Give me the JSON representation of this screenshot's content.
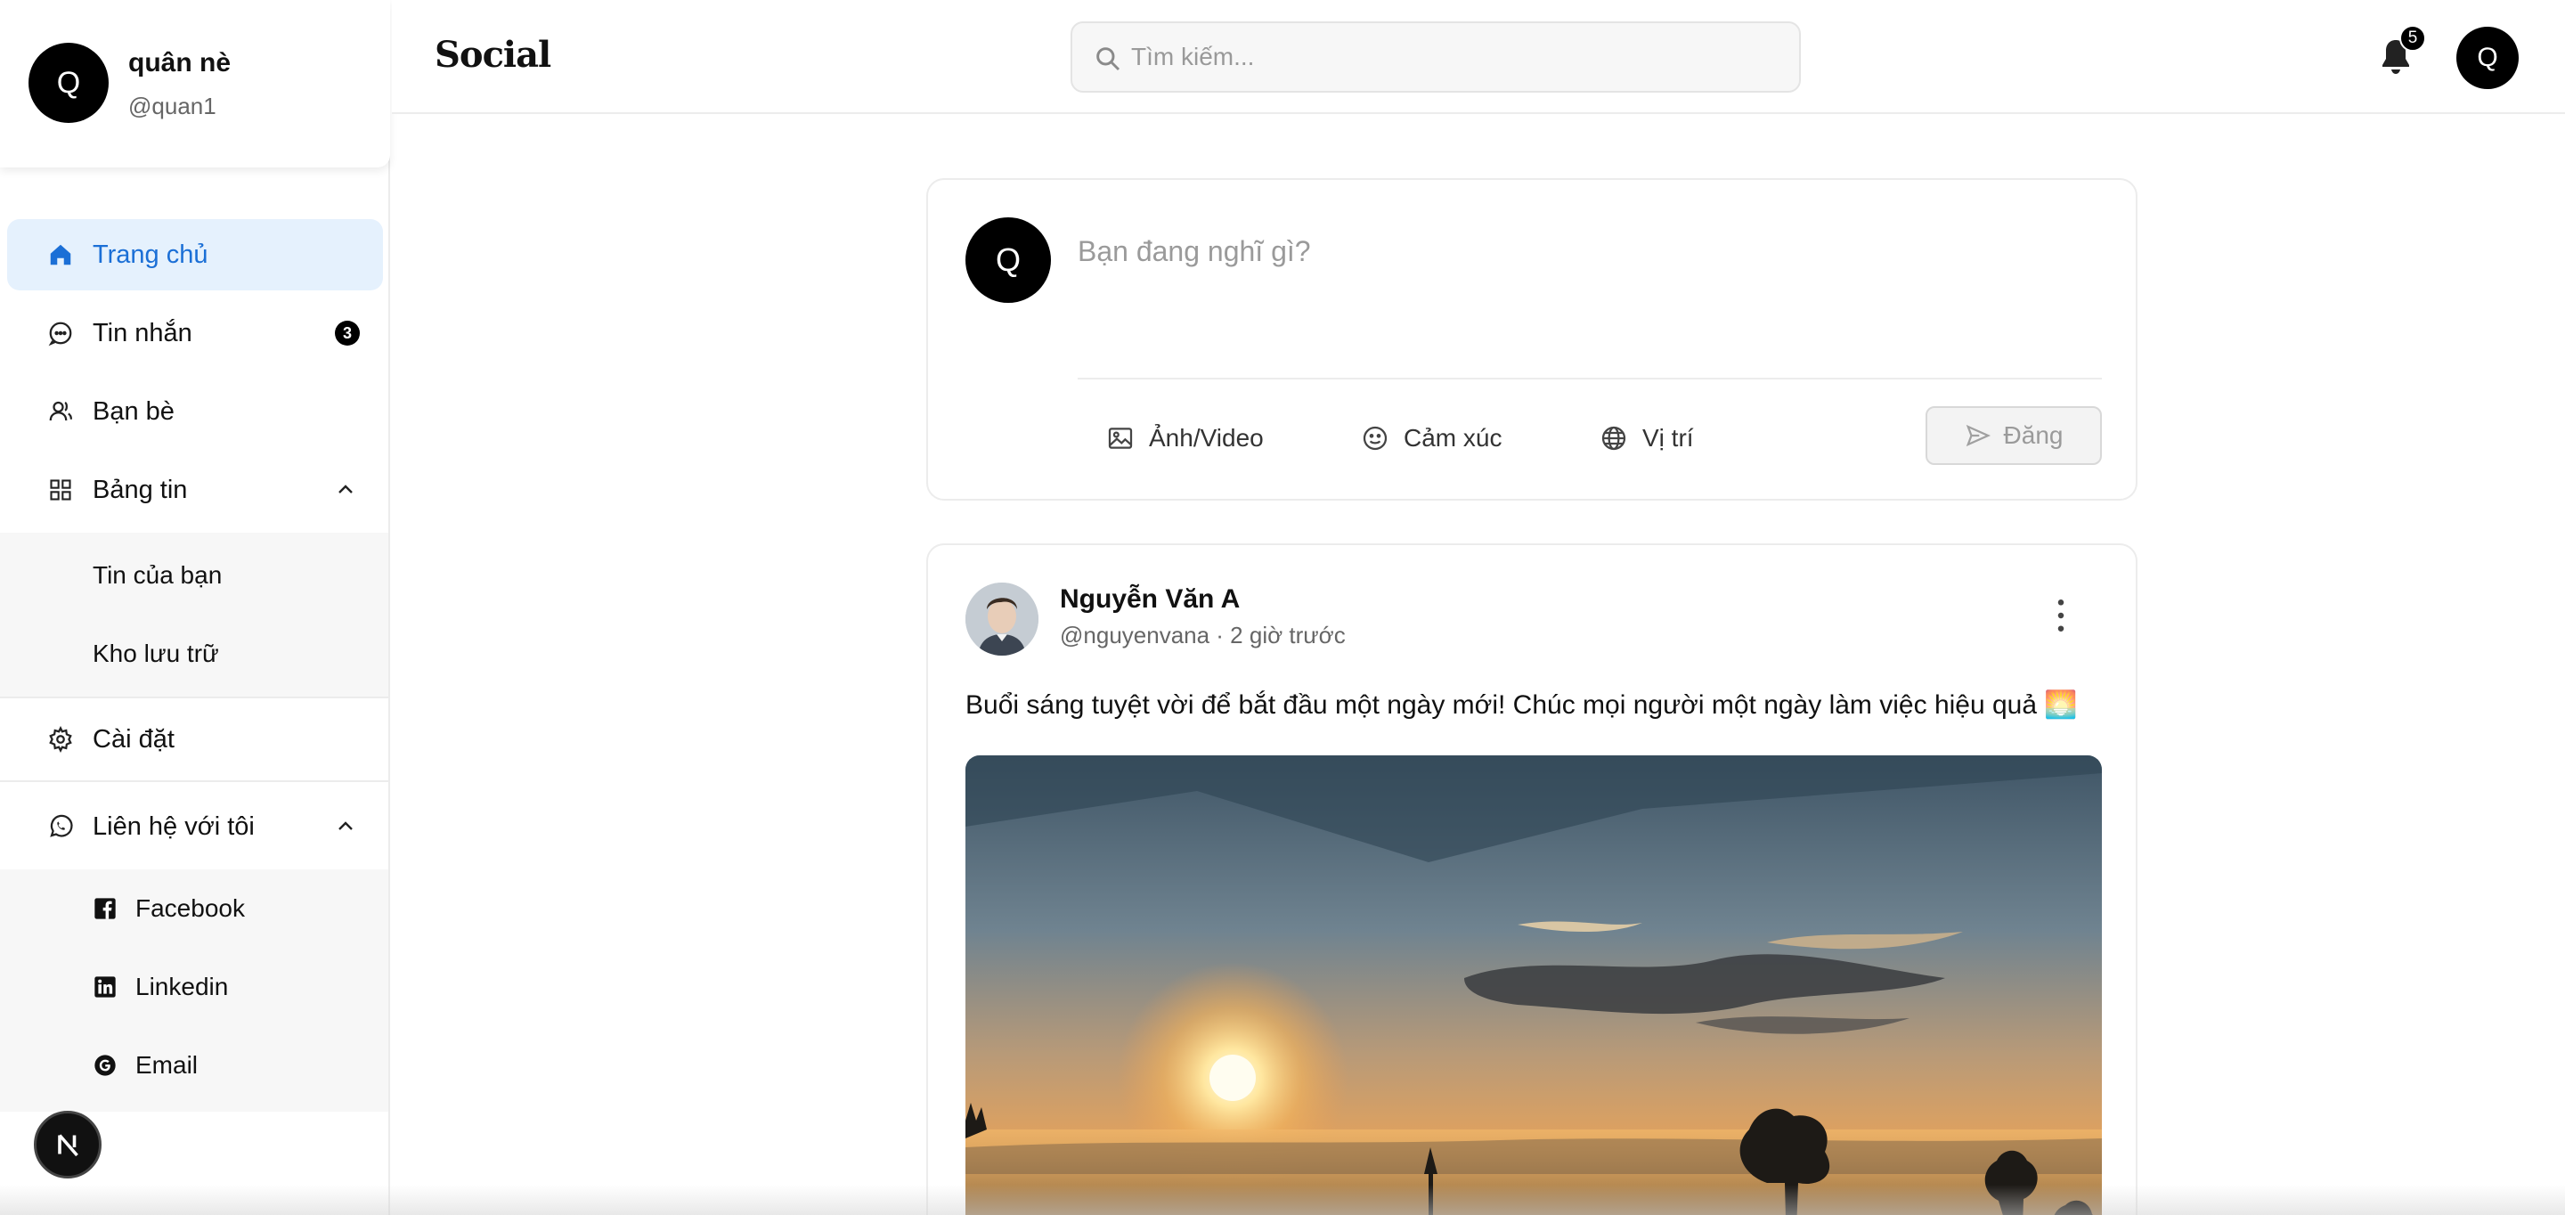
{
  "colors": {
    "accent": "#1b6fd6",
    "active_bg": "#e5f1fd",
    "badge": "#000000"
  },
  "profile": {
    "initial": "Q",
    "name": "quân nè",
    "handle": "@quan1"
  },
  "nav": {
    "home": {
      "label": "Trang chủ",
      "icon": "home-icon"
    },
    "messages": {
      "label": "Tin nhắn",
      "icon": "message-icon",
      "badge": "3"
    },
    "friends": {
      "label": "Bạn bè",
      "icon": "friends-icon"
    },
    "feed": {
      "label": "Bảng tin",
      "icon": "grid-icon",
      "children": [
        "Tin của bạn",
        "Kho lưu trữ"
      ]
    },
    "settings": {
      "label": "Cài đặt",
      "icon": "gear-icon"
    },
    "contact": {
      "label": "Liên hệ với tôi",
      "icon": "whatsapp-icon",
      "children": [
        "Facebook",
        "Linkedin",
        "Email"
      ]
    }
  },
  "header": {
    "brand": "Social",
    "search_placeholder": "Tìm kiếm...",
    "notification_count": "5",
    "avatar_initial": "Q"
  },
  "composer": {
    "avatar_initial": "Q",
    "placeholder": "Bạn đang nghĩ gì?",
    "actions": {
      "photo": "Ảnh/Video",
      "feeling": "Cảm xúc",
      "location": "Vị trí"
    },
    "post_label": "Đăng"
  },
  "post": {
    "author": "Nguyễn Văn A",
    "meta": "@nguyenvana · 2 giờ trước",
    "text": "Buổi sáng tuyệt vời để bắt đầu một ngày mới! Chúc mọi người một ngày làm việc hiệu quả 🌅"
  }
}
